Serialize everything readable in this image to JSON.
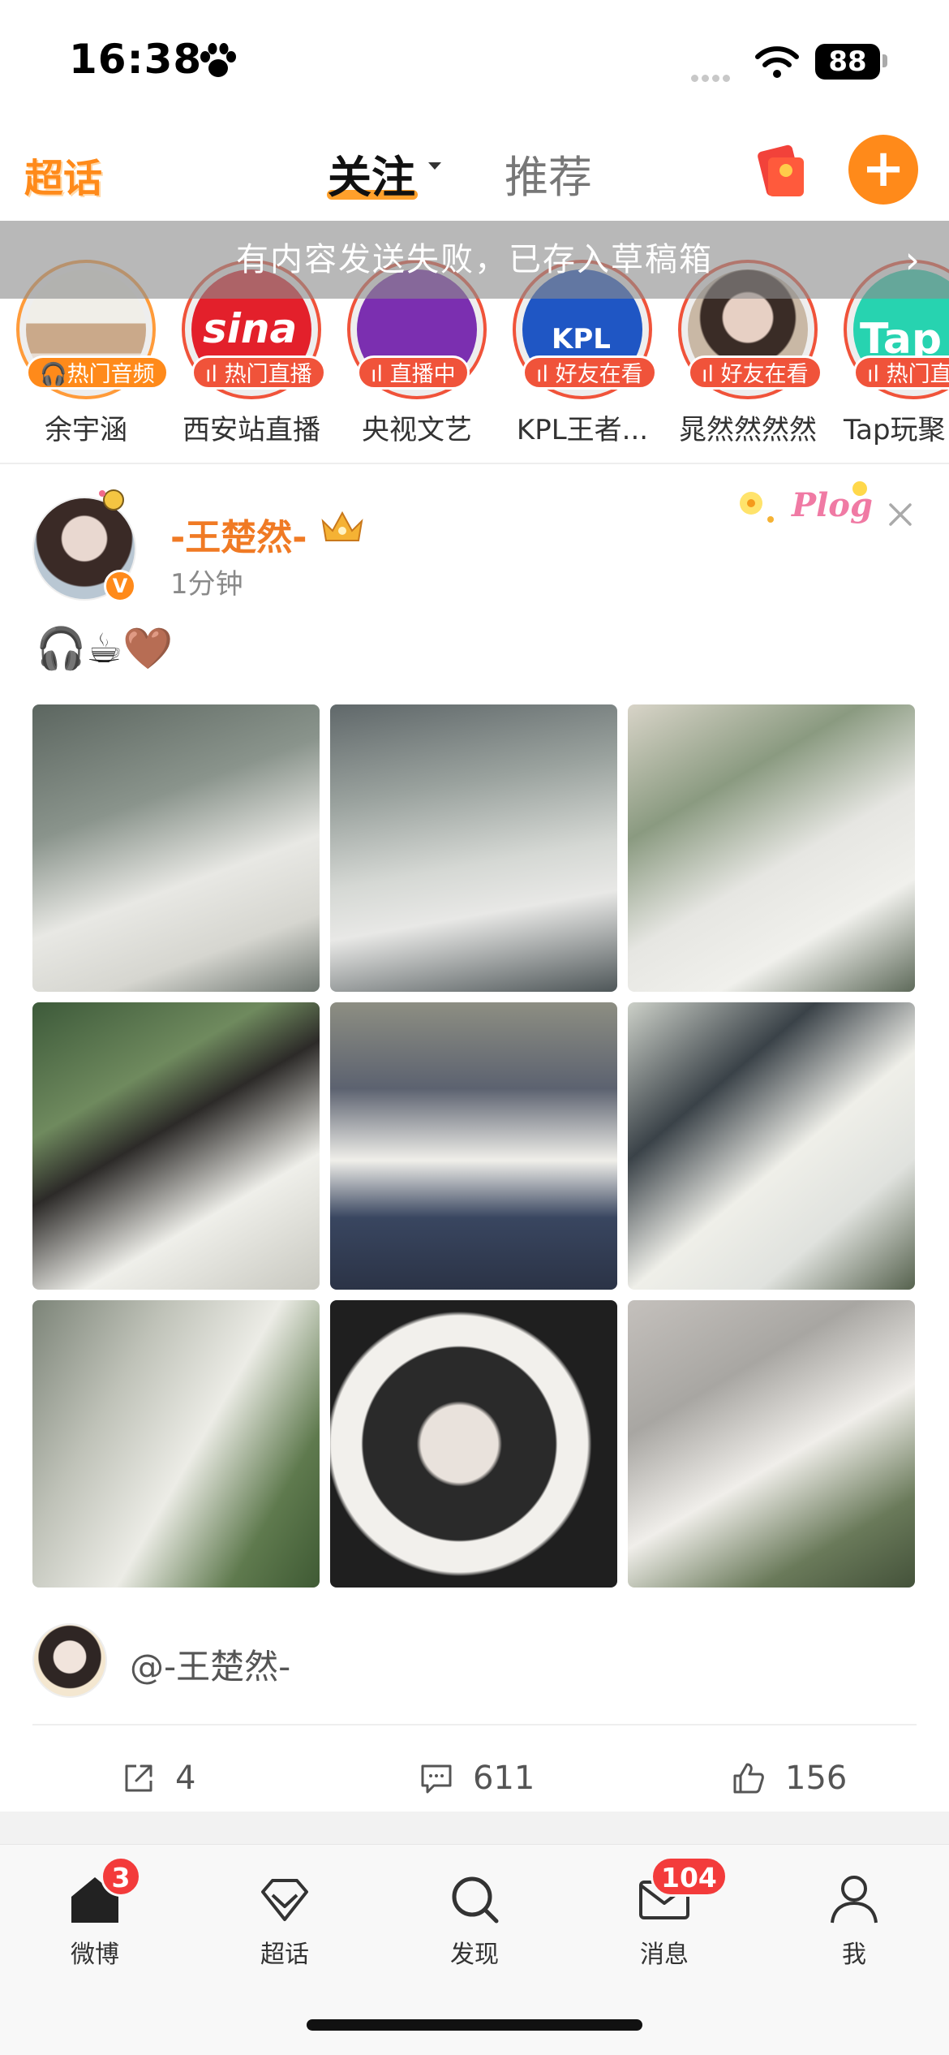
{
  "status_bar": {
    "time": "16:38",
    "battery": "88"
  },
  "nav": {
    "logo": "超话",
    "tab_follow": "关注",
    "tab_recommend": "推荐"
  },
  "toast": {
    "text": "有内容发送失败，已存入草稿箱"
  },
  "stories": [
    {
      "badge": "热门音频",
      "name": "余宇涵"
    },
    {
      "badge": "热门直播",
      "name": "西安站直播"
    },
    {
      "badge": "直播中",
      "name": "央视文艺"
    },
    {
      "badge": "好友在看",
      "name": "KPL王者..."
    },
    {
      "badge": "好友在看",
      "name": "晁然然然然"
    },
    {
      "badge": "热门直",
      "name": "Tap玩聚"
    }
  ],
  "post": {
    "username": "-王楚然-",
    "time": "1分钟",
    "text": "🎧☕🤎",
    "mention": "@-王楚然-",
    "repost_count": "4",
    "comment_count": "611",
    "like_count": "156"
  },
  "tabbar": {
    "items": [
      {
        "label": "微博",
        "badge": "3"
      },
      {
        "label": "超话",
        "badge": ""
      },
      {
        "label": "发现",
        "badge": ""
      },
      {
        "label": "消息",
        "badge": "104"
      },
      {
        "label": "我",
        "badge": ""
      }
    ]
  },
  "colors": {
    "accent": "#ff8a1a",
    "badge_red": "#f33b3b",
    "username": "#f07a24"
  }
}
